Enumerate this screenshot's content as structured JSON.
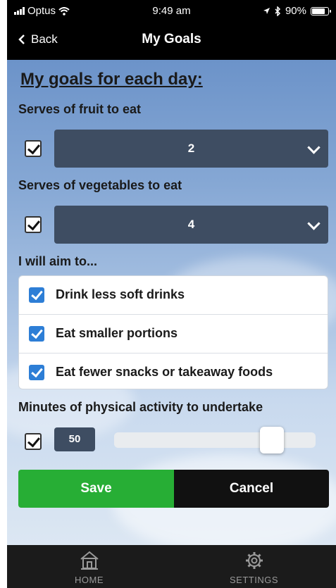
{
  "status_bar": {
    "carrier": "Optus",
    "time": "9:49 am",
    "battery": "90%",
    "battery_level": 0.9
  },
  "nav": {
    "back_label": "Back",
    "title": "My Goals"
  },
  "heading": "My goals for each day:",
  "fruit": {
    "label": "Serves of fruit to eat",
    "checked": true,
    "value": "2"
  },
  "vegetables": {
    "label": "Serves of vegetables to eat",
    "checked": true,
    "value": "4"
  },
  "aims": {
    "label": "I will aim to...",
    "items": [
      {
        "text": "Drink less soft drinks",
        "checked": true
      },
      {
        "text": "Eat smaller portions",
        "checked": true
      },
      {
        "text": "Eat fewer snacks or takeaway foods",
        "checked": true
      }
    ]
  },
  "activity": {
    "label": "Minutes of physical activity to undertake",
    "checked": true,
    "value": "50",
    "slider_fraction": 0.82
  },
  "buttons": {
    "save": "Save",
    "cancel": "Cancel"
  },
  "tabs": [
    {
      "label": "HOME",
      "icon": "home-icon"
    },
    {
      "label": "SETTINGS",
      "icon": "gear-icon"
    }
  ],
  "colors": {
    "save": "#27ae35",
    "cancel": "#111111",
    "select": "#3e4d62",
    "checkbox_blue": "#2d7ed6"
  }
}
